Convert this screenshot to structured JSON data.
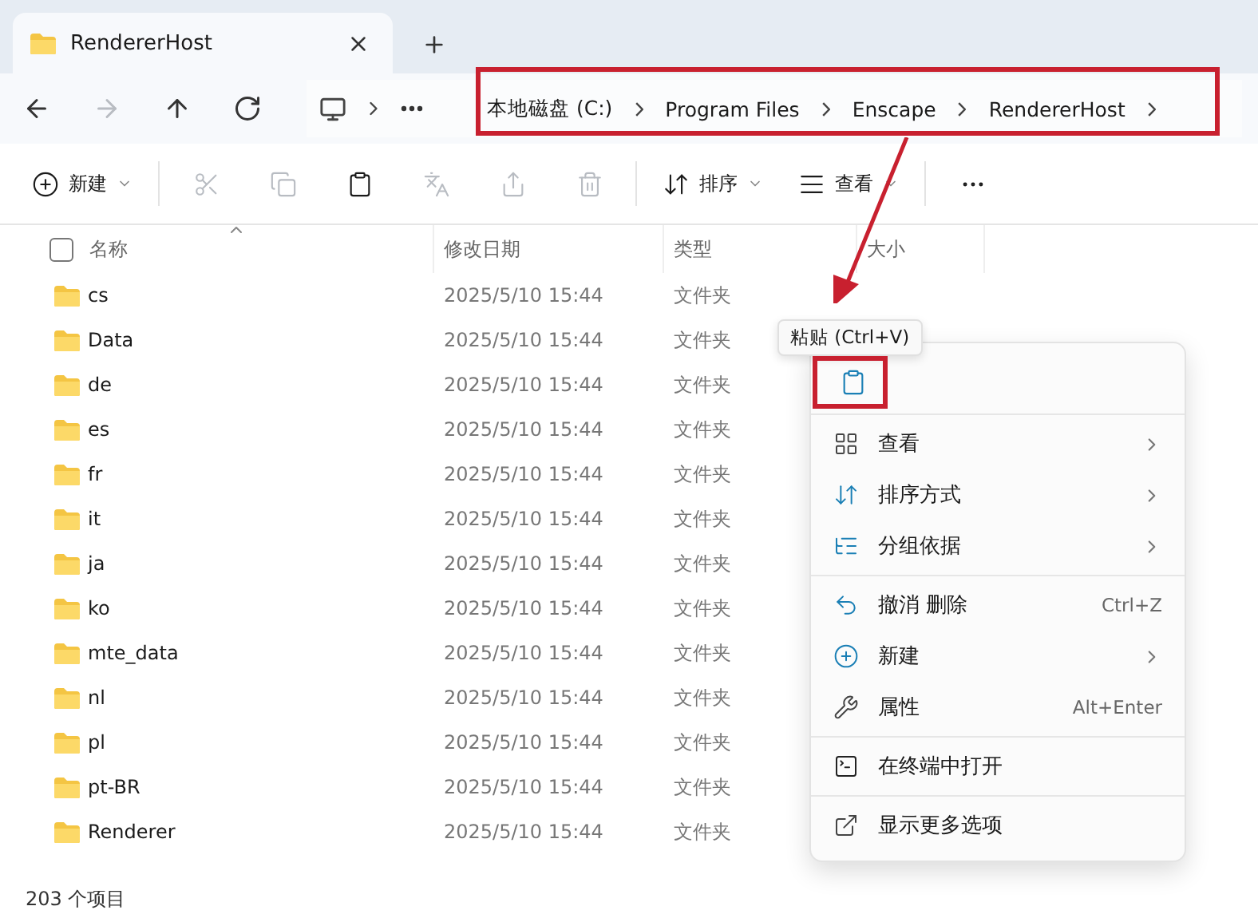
{
  "tab": {
    "title": "RendererHost"
  },
  "nav": [
    {
      "disabled": false
    },
    {
      "disabled": true
    },
    {
      "disabled": false
    },
    {
      "disabled": false
    }
  ],
  "breadcrumb": [
    "本地磁盘 (C:)",
    "Program Files",
    "Enscape",
    "RendererHost"
  ],
  "toolbar": [
    {
      "label": "新建",
      "dropdown": true,
      "disabled": false
    },
    {
      "disabled": true
    },
    {
      "disabled": true
    },
    {
      "disabled": false
    },
    {
      "disabled": true
    },
    {
      "disabled": true
    },
    {
      "disabled": true
    },
    {
      "label": "排序",
      "dropdown": true,
      "disabled": false
    },
    {
      "label": "查看",
      "dropdown": true,
      "disabled": false
    },
    {
      "disabled": false
    }
  ],
  "columns": [
    "名称",
    "修改日期",
    "类型",
    "大小"
  ],
  "header_checkbox": {
    "checked": false
  },
  "rows": [
    {
      "name": "cs",
      "date": "2025/5/10 15:44",
      "type": "文件夹"
    },
    {
      "name": "Data",
      "date": "2025/5/10 15:44",
      "type": "文件夹"
    },
    {
      "name": "de",
      "date": "2025/5/10 15:44",
      "type": "文件夹"
    },
    {
      "name": "es",
      "date": "2025/5/10 15:44",
      "type": "文件夹"
    },
    {
      "name": "fr",
      "date": "2025/5/10 15:44",
      "type": "文件夹"
    },
    {
      "name": "it",
      "date": "2025/5/10 15:44",
      "type": "文件夹"
    },
    {
      "name": "ja",
      "date": "2025/5/10 15:44",
      "type": "文件夹"
    },
    {
      "name": "ko",
      "date": "2025/5/10 15:44",
      "type": "文件夹"
    },
    {
      "name": "mte_data",
      "date": "2025/5/10 15:44",
      "type": "文件夹"
    },
    {
      "name": "nl",
      "date": "2025/5/10 15:44",
      "type": "文件夹"
    },
    {
      "name": "pl",
      "date": "2025/5/10 15:44",
      "type": "文件夹"
    },
    {
      "name": "pt-BR",
      "date": "2025/5/10 15:44",
      "type": "文件夹"
    },
    {
      "name": "Renderer",
      "date": "2025/5/10 15:44",
      "type": "文件夹"
    }
  ],
  "status_bar": "203 个项目",
  "tooltip": "粘贴 (Ctrl+V)",
  "context_menu": {
    "sections": [
      [
        {
          "label": "查看",
          "submenu": true
        },
        {
          "label": "排序方式",
          "submenu": true
        },
        {
          "label": "分组依据",
          "submenu": true
        }
      ],
      [
        {
          "label": "撤消 删除",
          "shortcut": "Ctrl+Z"
        },
        {
          "label": "新建",
          "submenu": true
        },
        {
          "label": "属性",
          "shortcut": "Alt+Enter"
        }
      ],
      [
        {
          "label": "在终端中打开"
        }
      ],
      [
        {
          "label": "显示更多选项"
        }
      ]
    ]
  }
}
